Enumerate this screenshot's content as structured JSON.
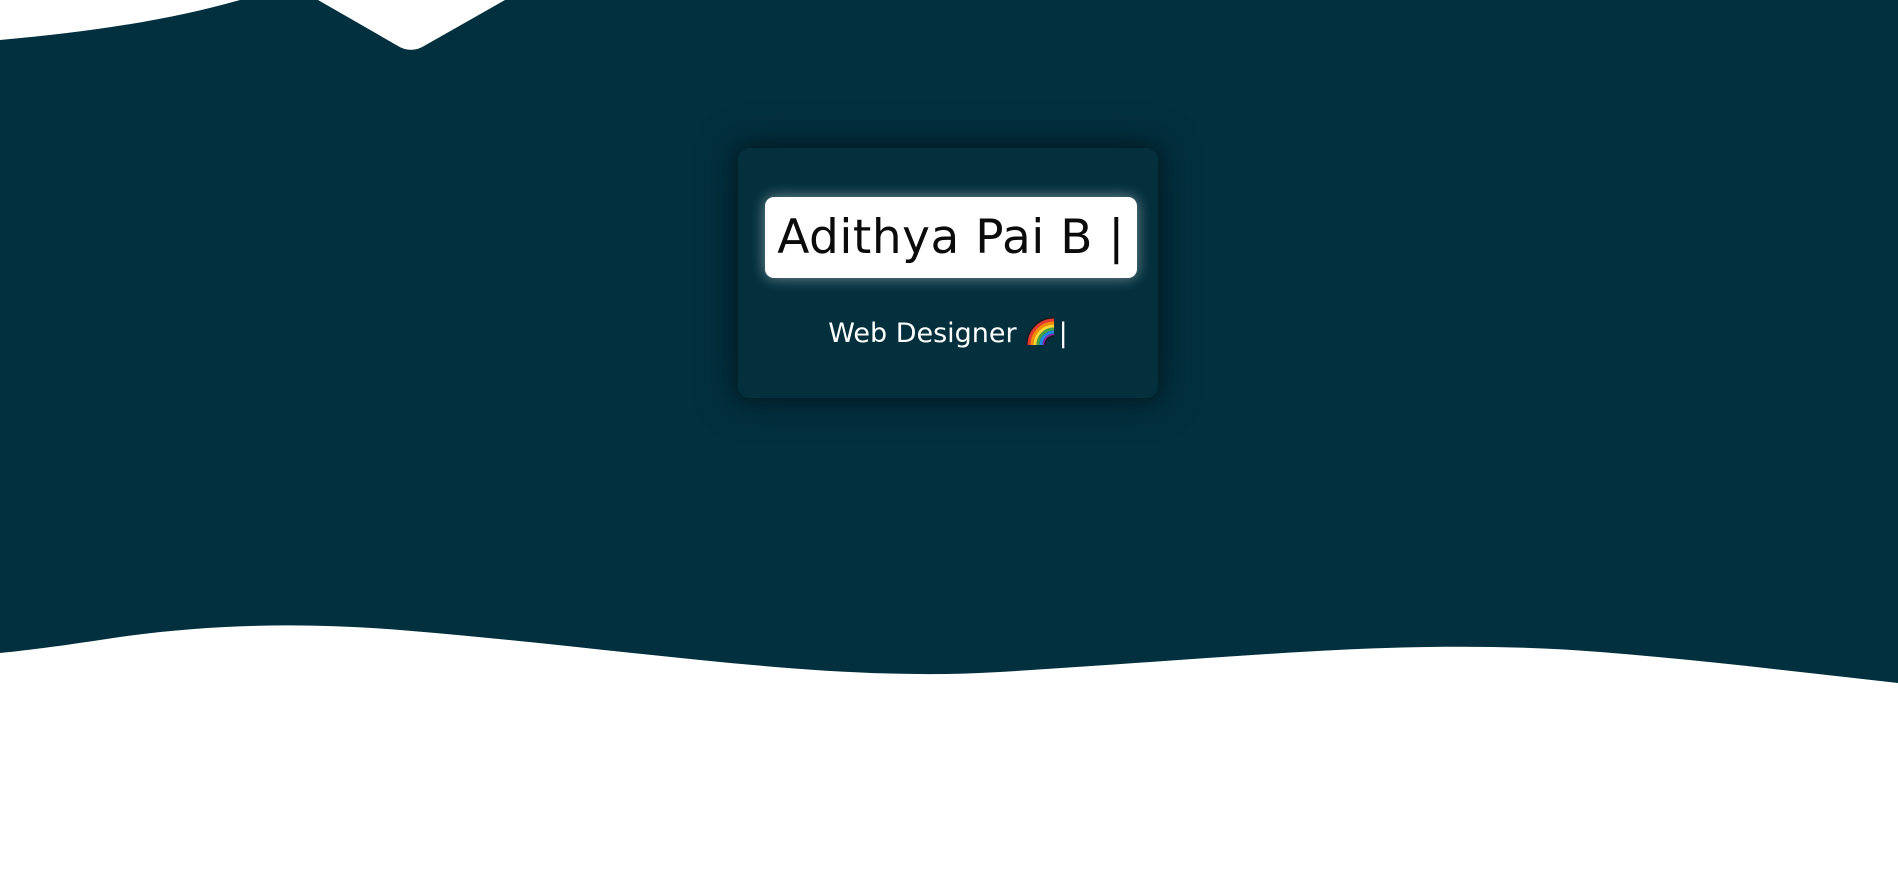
{
  "hero": {
    "background_color": "#03303f",
    "wave_color": "#ffffff"
  },
  "intro": {
    "name": "Adithya Pai B |",
    "role": "Web Designer",
    "role_icon": "rainbow-icon",
    "role_cursor": "|"
  }
}
